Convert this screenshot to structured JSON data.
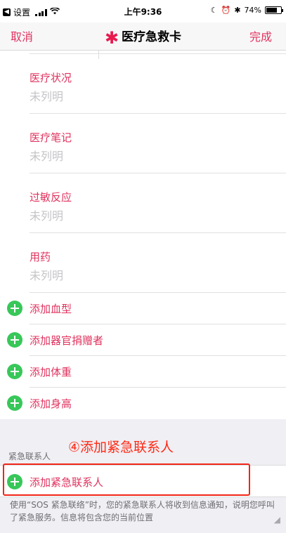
{
  "status_bar": {
    "back_app": "设置",
    "time": "上午9:36",
    "battery": "74%",
    "battery_level": 0.74
  },
  "nav": {
    "cancel": "取消",
    "title": "医疗急救卡",
    "done": "完成"
  },
  "fields": [
    {
      "label": "医疗状况",
      "value": "未列明"
    },
    {
      "label": "医疗笔记",
      "value": "未列明"
    },
    {
      "label": "过敏反应",
      "value": "未列明"
    },
    {
      "label": "用药",
      "value": "未列明"
    }
  ],
  "add_rows": [
    {
      "label": "添加血型"
    },
    {
      "label": "添加器官捐赠者"
    },
    {
      "label": "添加体重"
    },
    {
      "label": "添加身高"
    }
  ],
  "emergency": {
    "section_header": "紧急联系人",
    "annotation": "④添加紧急联系人",
    "add_contact": "添加紧急联系人",
    "footer": "使用“SOS 紧急联络”时，您的紧急联系人将收到信息通知，说明您呼叫了紧急服务。信息将包含您的当前位置"
  },
  "colors": {
    "accent": "#e0335e",
    "plus_green": "#38c759",
    "annotation_red": "#ff2a14"
  }
}
